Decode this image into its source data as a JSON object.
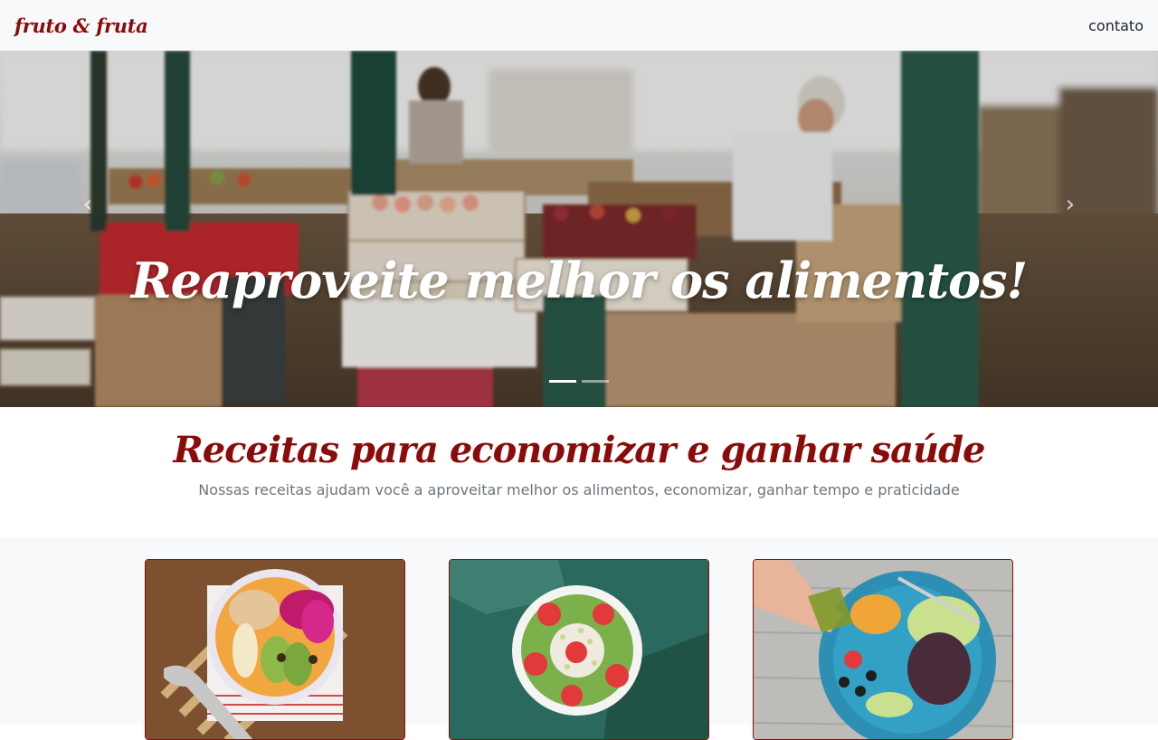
{
  "navbar": {
    "brand": "fruto & fruta",
    "contact_link": "contato"
  },
  "hero": {
    "caption": "Reaproveite melhor os alimentos!",
    "prev_icon": "chevron-left-icon",
    "next_icon": "chevron-right-icon",
    "slide_count": 2,
    "active_slide": 1
  },
  "intro": {
    "title": "Receitas para economizar e ganhar saúde",
    "subtitle": "Nossas receitas ajudam você a aproveitar melhor os alimentos, economizar, ganhar tempo e praticidade"
  },
  "colors": {
    "accent": "#8b0a0a",
    "navbar_bg": "#f8f9fa",
    "muted_text": "#6c757d"
  },
  "cards": [
    {
      "name": "smoothie-bowl-card"
    },
    {
      "name": "kiwi-bowl-card"
    },
    {
      "name": "salad-plate-card"
    }
  ]
}
